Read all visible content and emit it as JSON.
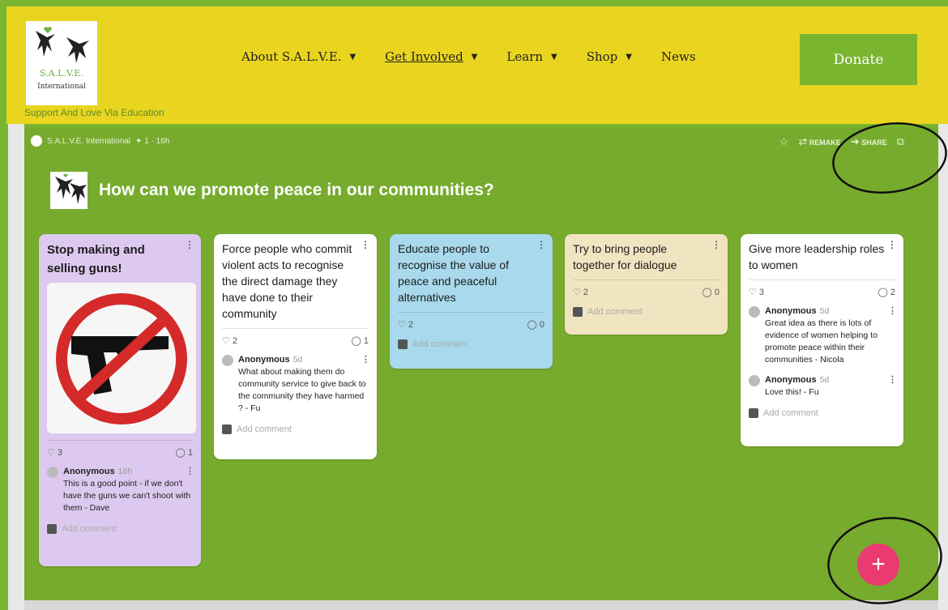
{
  "header": {
    "logo_text": "S.A.L.V.E.",
    "logo_subtext": "International",
    "tagline": "Support And Love Via Education",
    "nav": [
      {
        "label": "About S.A.L.V.E."
      },
      {
        "label": "Get Involved"
      },
      {
        "label": "Learn"
      },
      {
        "label": "Shop"
      },
      {
        "label": "News"
      }
    ],
    "donate_label": "Donate"
  },
  "padlet": {
    "author": "S.A.L.V.E. International",
    "meta": "✦ 1 · 16h",
    "actions": {
      "remake": "REMAKE",
      "share": "SHARE"
    },
    "title": "How can we promote peace in our communities?",
    "posts": [
      {
        "subject": "Stop making and selling guns!",
        "likes": "3",
        "comments": "1",
        "thread": [
          {
            "name": "Anonymous",
            "time": "16h",
            "text": "This is a good point - if we don't have the guns we can't shoot with them - Dave"
          }
        ],
        "add_comment": "Add comment",
        "color": "#ddc9ef"
      },
      {
        "subject": "Force people who commit violent acts to recognise the direct damage they have done to their community",
        "likes": "2",
        "comments": "1",
        "thread": [
          {
            "name": "Anonymous",
            "time": "5d",
            "text": "What about making them do community service to give back to the community they have harmed ? - Fu"
          }
        ],
        "add_comment": "Add comment",
        "color": "#ffffff"
      },
      {
        "subject": "Educate people to recognise the value of peace and peaceful alternatives",
        "likes": "2",
        "comments": "0",
        "add_comment": "Add comment",
        "color": "#a8d9ec"
      },
      {
        "subject": "Try to bring people together for dialogue",
        "likes": "2",
        "comments": "0",
        "add_comment": "Add comment",
        "color": "#f1e4c1"
      },
      {
        "subject": "Give more leadership roles to women",
        "likes": "3",
        "comments": "2",
        "thread": [
          {
            "name": "Anonymous",
            "time": "5d",
            "text": "Great idea as there is lots of evidence of women helping to promote peace within their communities - Nicola"
          },
          {
            "name": "Anonymous",
            "time": "5d",
            "text": "Love this! - Fu"
          }
        ],
        "add_comment": "Add comment",
        "color": "#ffffff"
      }
    ],
    "fab_label": "+"
  },
  "colors": {
    "header": "#e9d51f",
    "accent": "#7ab52f",
    "fab": "#ea3a72"
  }
}
